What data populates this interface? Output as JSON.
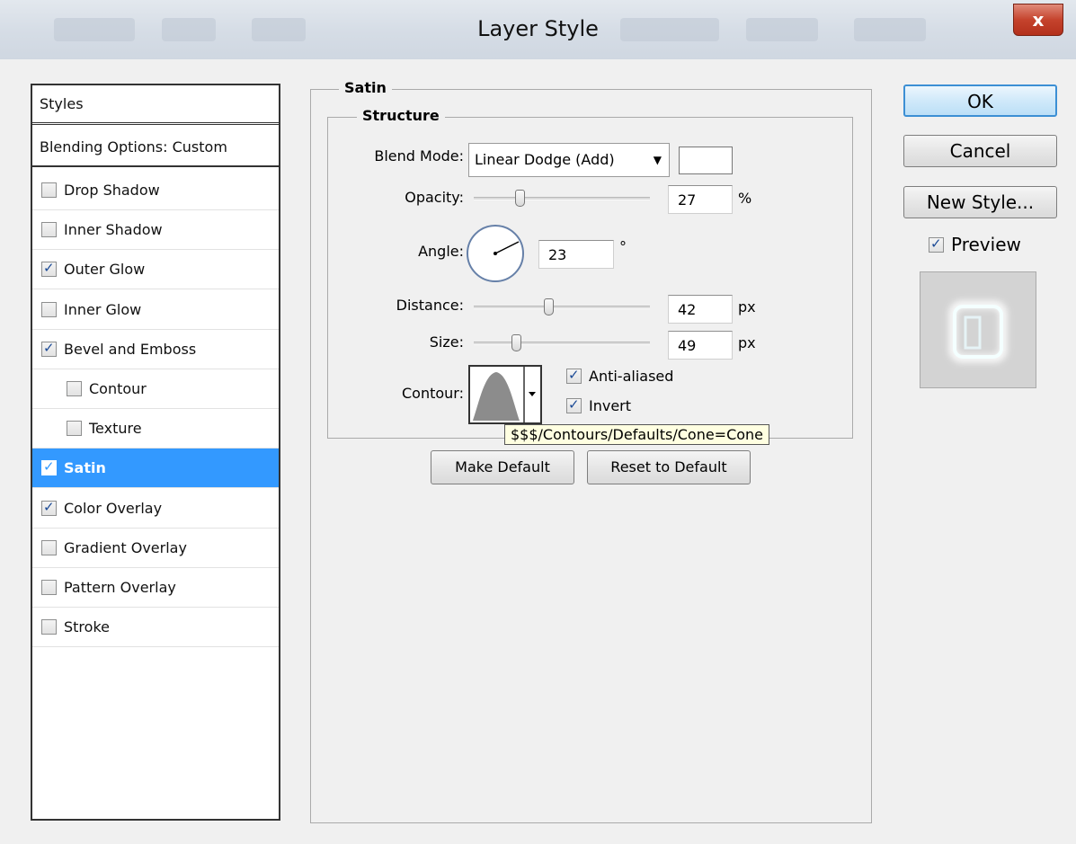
{
  "window": {
    "title": "Layer Style",
    "close_label": "x"
  },
  "styles_list": {
    "header": "Styles",
    "blending_options": "Blending Options: Custom",
    "items": [
      {
        "label": "Drop Shadow",
        "checked": false,
        "selected": false,
        "indent": false
      },
      {
        "label": "Inner Shadow",
        "checked": false,
        "selected": false,
        "indent": false
      },
      {
        "label": "Outer Glow",
        "checked": true,
        "selected": false,
        "indent": false
      },
      {
        "label": "Inner Glow",
        "checked": false,
        "selected": false,
        "indent": false
      },
      {
        "label": "Bevel and Emboss",
        "checked": true,
        "selected": false,
        "indent": false
      },
      {
        "label": "Contour",
        "checked": false,
        "selected": false,
        "indent": true
      },
      {
        "label": "Texture",
        "checked": false,
        "selected": false,
        "indent": true
      },
      {
        "label": "Satin",
        "checked": true,
        "selected": true,
        "indent": false
      },
      {
        "label": "Color Overlay",
        "checked": true,
        "selected": false,
        "indent": false
      },
      {
        "label": "Gradient Overlay",
        "checked": false,
        "selected": false,
        "indent": false
      },
      {
        "label": "Pattern Overlay",
        "checked": false,
        "selected": false,
        "indent": false
      },
      {
        "label": "Stroke",
        "checked": false,
        "selected": false,
        "indent": false
      }
    ]
  },
  "satin": {
    "group_title": "Satin",
    "structure_title": "Structure",
    "blend_mode": {
      "label": "Blend Mode:",
      "value": "Linear Dodge (Add)",
      "swatch_color": "#ffffff"
    },
    "opacity": {
      "label": "Opacity:",
      "value": "27",
      "unit": "%"
    },
    "angle": {
      "label": "Angle:",
      "value": "23",
      "unit": "°"
    },
    "distance": {
      "label": "Distance:",
      "value": "42",
      "unit": "px"
    },
    "size": {
      "label": "Size:",
      "value": "49",
      "unit": "px"
    },
    "contour": {
      "label": "Contour:",
      "tooltip": "$$$/Contours/Defaults/Cone=Cone"
    },
    "anti_aliased": {
      "label": "Anti-aliased",
      "checked": true
    },
    "invert": {
      "label": "Invert",
      "checked": true
    },
    "make_default": "Make Default",
    "reset_default": "Reset to Default"
  },
  "actions": {
    "ok": "OK",
    "cancel": "Cancel",
    "new_style": "New Style...",
    "preview": {
      "label": "Preview",
      "checked": true
    }
  },
  "colors": {
    "selection": "#3399ff",
    "ok_border": "#3c8fd4",
    "close_red": "#c5432d"
  }
}
